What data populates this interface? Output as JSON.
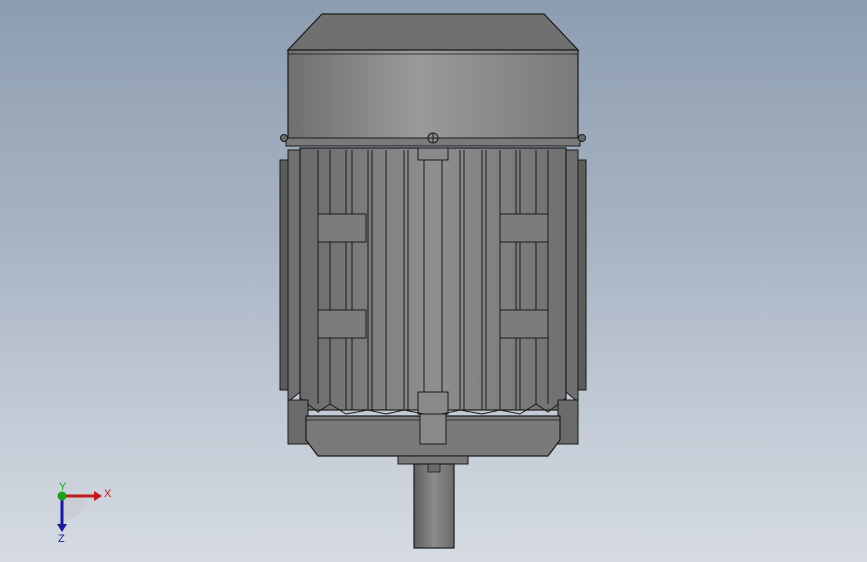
{
  "viewport": {
    "background_top": "#8d9db0",
    "background_bottom": "#d6dbe2"
  },
  "model": {
    "body_color": "#8a8a8a",
    "edge_color": "#1a1a1a",
    "fin_count": 16
  },
  "triad": {
    "x_label": "X",
    "y_label": "Y",
    "z_label": "Z",
    "x_color": "#c01a1a",
    "y_color": "#1aa01a",
    "z_color": "#1a1aa0"
  }
}
